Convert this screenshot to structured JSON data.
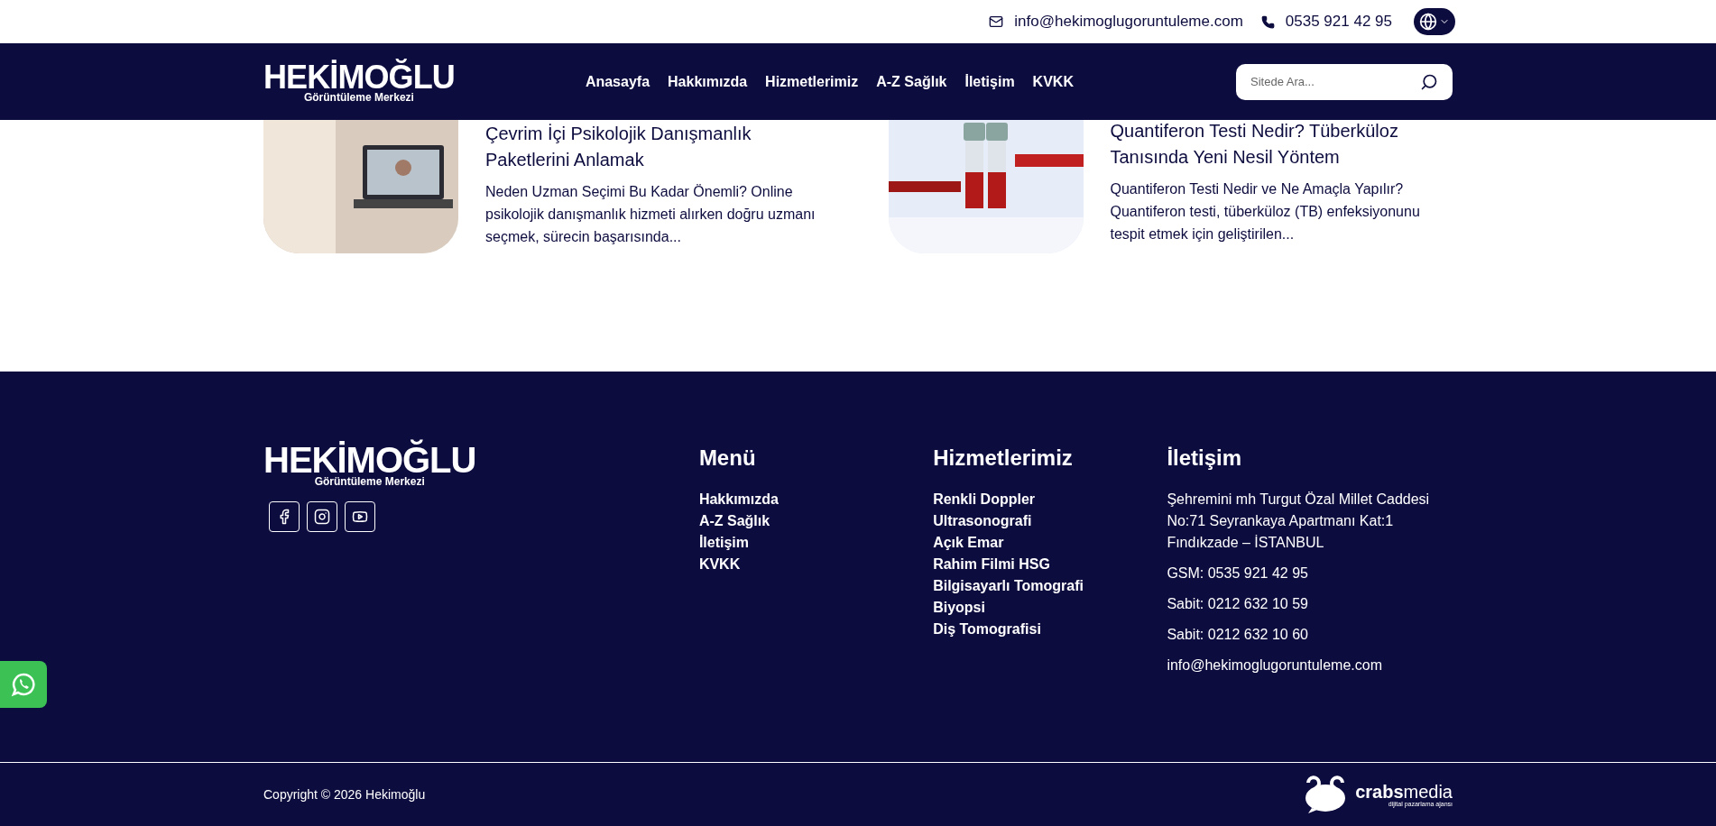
{
  "top_bar": {
    "email": "info@hekimoglugoruntuleme.com",
    "phone": "0535 921 42 95"
  },
  "header": {
    "logo": {
      "name": "HEKİMOĞLU",
      "tagline": "Görüntüleme Merkezi"
    },
    "nav": [
      {
        "label": "Anasayfa"
      },
      {
        "label": "Hakkımızda"
      },
      {
        "label": "Hizmetlerimiz"
      },
      {
        "label": "A-Z Sağlık"
      },
      {
        "label": "İletişim"
      },
      {
        "label": "KVKK"
      }
    ],
    "search": {
      "placeholder": "Sitede Ara..."
    }
  },
  "posts": [
    {
      "kind": "laptop",
      "title": "Çevrim İçi Psikolojik Danışmanlık Paketlerini Anlamak",
      "excerpt": "Neden Uzman Seçimi Bu Kadar Önemli? Online psikolojik danışmanlık hizmeti alırken doğru uzmanı seçmek, sürecin başarısında..."
    },
    {
      "kind": "tubes",
      "title": "Quantiferon Testi Nedir? Tüberküloz Tanısında Yeni Nesil Yöntem",
      "excerpt": "Quantiferon Testi Nedir ve Ne Amaçla Yapılır? Quantiferon testi, tüberküloz (TB) enfeksiyonunu tespit etmek için geliştirilen..."
    }
  ],
  "footer": {
    "logo": {
      "name": "HEKİMOĞLU",
      "tagline": "Görüntüleme Merkezi"
    },
    "columns": [
      {
        "title": "Menü",
        "links": [
          "Hakkımızda",
          "A-Z Sağlık",
          "İletişim",
          "KVKK"
        ]
      },
      {
        "title": "Hizmetlerimiz",
        "links": [
          "Renkli Doppler",
          "Ultrasonografi",
          "Açık Emar",
          "Rahim Filmi HSG",
          "Bilgisayarlı Tomografi",
          "Biyopsi",
          "Diş Tomografisi"
        ]
      }
    ],
    "contact": {
      "title": "İletişim",
      "address": "Şehremini mh Turgut Özal Millet Caddesi No:71 Seyrankaya Apartmanı Kat:1 Fındıkzade – İSTANBUL",
      "lines": [
        "GSM: 0535 921 42 95",
        "Sabit: 0212 632 10 59",
        "Sabit: 0212 632 10 60",
        "info@hekimoglugoruntuleme.com"
      ]
    },
    "copyright": "Copyright © 2026 Hekimoğlu",
    "agency": {
      "name_bold": "crabs",
      "name_light": "media",
      "tagline": "dijital pazarlama ajansı"
    }
  }
}
